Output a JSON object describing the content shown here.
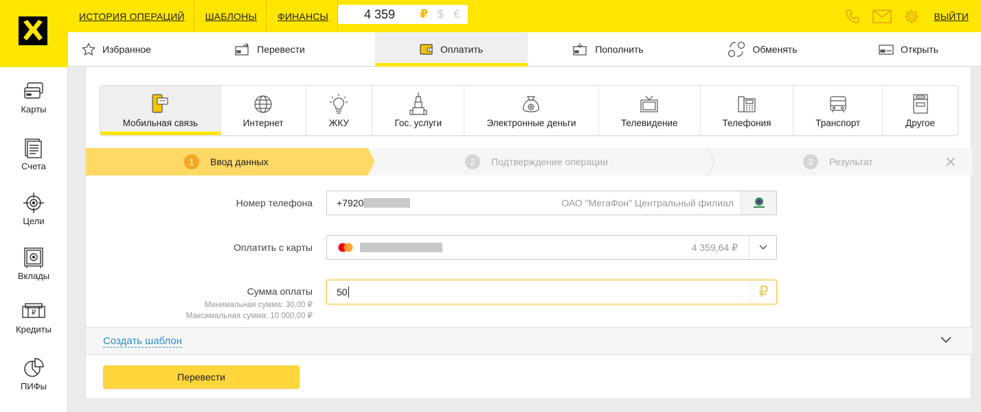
{
  "brand": {
    "accent": "#fee600",
    "logo_icon": "raiffeisen-logo-icon"
  },
  "header": {
    "links": [
      "ИСТОРИЯ ОПЕРАЦИЙ",
      "ШАБЛОНЫ",
      "ФИНАНСЫ"
    ],
    "balance": {
      "amount": "4 359",
      "currencies": [
        "₽",
        "$",
        "€"
      ],
      "active_currency": "₽"
    },
    "icons": [
      "phone-icon",
      "mail-icon",
      "gear-icon"
    ],
    "logout": "ВЫЙТИ"
  },
  "nav": {
    "items": [
      {
        "label": "Избранное",
        "icon": "star-icon"
      },
      {
        "label": "Перевести",
        "icon": "transfer-icon"
      },
      {
        "label": "Оплатить",
        "icon": "wallet-icon",
        "active": true
      },
      {
        "label": "Пополнить",
        "icon": "topup-icon"
      },
      {
        "label": "Обменять",
        "icon": "exchange-icon"
      },
      {
        "label": "Открыть",
        "icon": "open-card-icon"
      }
    ]
  },
  "sidebar": {
    "items": [
      {
        "label": "Карты",
        "icon": "cards-icon"
      },
      {
        "label": "Счета",
        "icon": "accounts-icon"
      },
      {
        "label": "Цели",
        "icon": "target-icon"
      },
      {
        "label": "Вклады",
        "icon": "safe-icon"
      },
      {
        "label": "Кредиты",
        "icon": "credits-icon"
      },
      {
        "label": "ПИФы",
        "icon": "funds-pie-icon"
      }
    ]
  },
  "categories": [
    {
      "label": "Мобильная связь",
      "icon": "mobile-icon",
      "active": true
    },
    {
      "label": "Интернет",
      "icon": "globe-icon"
    },
    {
      "label": "ЖКУ",
      "icon": "bulb-icon"
    },
    {
      "label": "Гос. услуги",
      "icon": "kremlin-icon"
    },
    {
      "label": "Электронные деньги",
      "icon": "money-bag-icon"
    },
    {
      "label": "Телевидение",
      "icon": "tv-icon"
    },
    {
      "label": "Телефония",
      "icon": "landline-icon"
    },
    {
      "label": "Транспорт",
      "icon": "bus-icon"
    },
    {
      "label": "Другое",
      "icon": "cabinet-icon"
    }
  ],
  "steps": [
    {
      "num": "1",
      "label": "Ввод данных",
      "active": true
    },
    {
      "num": "2",
      "label": "Подтверждение операции"
    },
    {
      "num": "3",
      "label": "Результат"
    }
  ],
  "close_icon": "close-icon",
  "form": {
    "phone": {
      "label": "Номер телефона",
      "value_prefix": "+7920",
      "operator": "ОАО \"МегаФон\" Центральный филиал"
    },
    "card": {
      "label": "Оплатить с карты",
      "balance": "4 359,64 ₽"
    },
    "amount": {
      "label": "Сумма оплаты",
      "min_hint": "Минимальная сумма: 30,00 ₽",
      "max_hint": "Максимальная сумма: 10 000,00 ₽",
      "value": "50",
      "currency": "₽"
    }
  },
  "template": {
    "link": "Создать шаблон"
  },
  "submit": {
    "label": "Перевести"
  }
}
